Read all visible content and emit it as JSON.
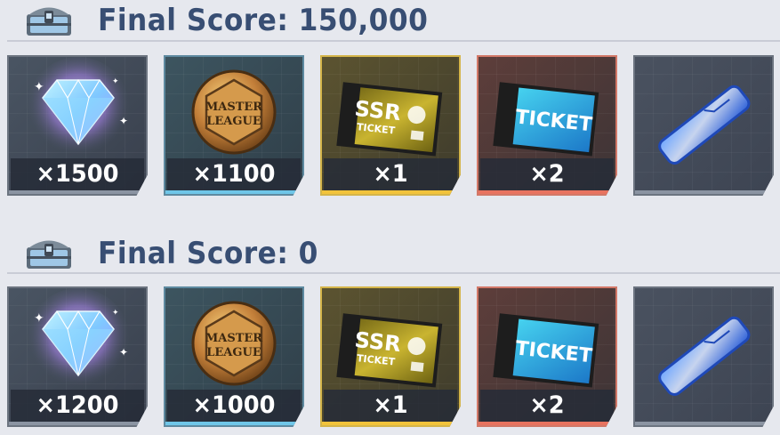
{
  "sections": [
    {
      "title": "Final Score: 150,000",
      "chest_icon": "reward-chest-icon",
      "rewards": [
        {
          "name": "gem",
          "icon": "gem-icon",
          "quantity": "×1500"
        },
        {
          "name": "master-league-coin",
          "icon": "master-league-coin-icon",
          "quantity": "×1100"
        },
        {
          "name": "ssr-ticket",
          "icon": "ssr-ticket-icon",
          "quantity": "×1"
        },
        {
          "name": "ticket",
          "icon": "ticket-icon",
          "quantity": "×2"
        },
        {
          "name": "blue-chip",
          "icon": "blue-chip-icon",
          "quantity": ""
        }
      ]
    },
    {
      "title": "Final Score: 0",
      "chest_icon": "reward-chest-icon",
      "rewards": [
        {
          "name": "gem",
          "icon": "gem-icon",
          "quantity": "×1200"
        },
        {
          "name": "master-league-coin",
          "icon": "master-league-coin-icon",
          "quantity": "×1000"
        },
        {
          "name": "ssr-ticket",
          "icon": "ssr-ticket-icon",
          "quantity": "×1"
        },
        {
          "name": "ticket",
          "icon": "ticket-icon",
          "quantity": "×2"
        },
        {
          "name": "blue-chip",
          "icon": "blue-chip-icon",
          "quantity": ""
        }
      ]
    }
  ],
  "item_labels": {
    "coin_line1": "MASTER",
    "coin_line2": "LEAGUE",
    "ssr_line1": "SSR",
    "ssr_line2": "TICKET",
    "ticket_text": "TICKET",
    "stub_text": "TICKET"
  },
  "colors": {
    "title": "#384e73",
    "background": "#e6e8ee",
    "gold_frame": "#f2c33b",
    "red_frame": "#e8735f",
    "blue_frame": "#6fc6e8"
  }
}
